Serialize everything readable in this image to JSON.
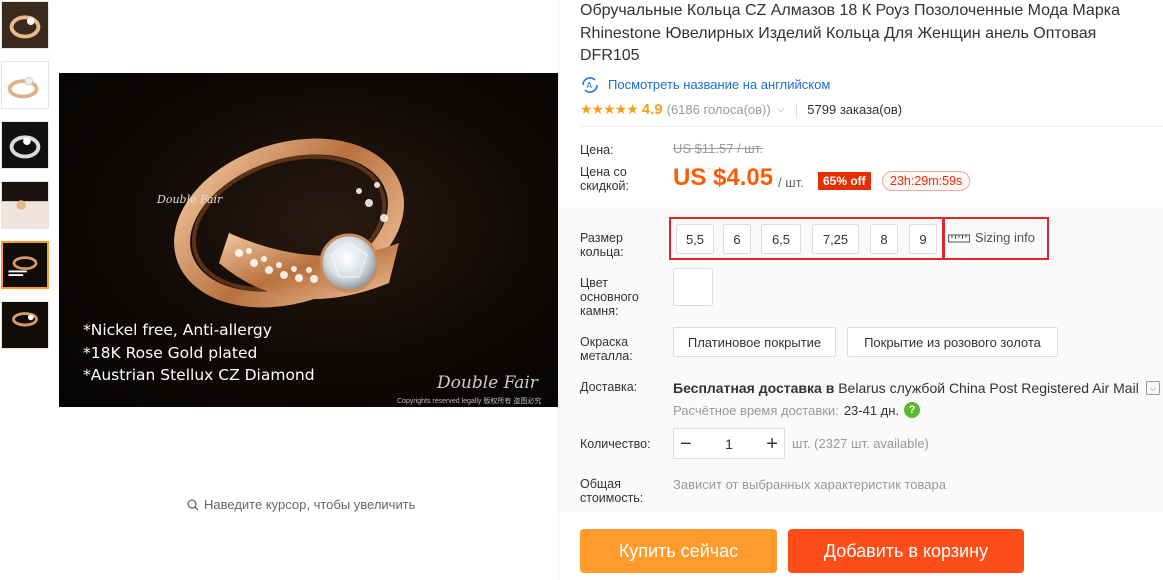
{
  "title": "Обручальные Кольца CZ Алмазов 18 К Роуз Позолоченные Мода Марка Rhinestone Ювелирных Изделий Кольца Для Женщин анель Оптовая DFR105",
  "translate_link": "Посмотреть название на английском",
  "rating": {
    "value": "4.9",
    "votes": "(6186 голоса(ов))",
    "orders": "5799 заказа(ов)",
    "stars": 5
  },
  "price": {
    "label": "Цена:",
    "old": "US $11.57 / шт.",
    "discount_label_1": "Цена со",
    "discount_label_2": "скидкой:",
    "new": "US $4.05",
    "per": "/ шт.",
    "off": "65% off",
    "timer": "23h:29m:59s"
  },
  "ring_size": {
    "label_1": "Размер",
    "label_2": "кольца:",
    "options": [
      "5,5",
      "6",
      "6,5",
      "7,25",
      "8",
      "9"
    ],
    "sizing_info": "Sizing info"
  },
  "stone_color": {
    "label_1": "Цвет",
    "label_2": "основного",
    "label_3": "камня:"
  },
  "metal": {
    "label_1": "Окраска",
    "label_2": "металла:",
    "options": [
      "Платиновое покрытие",
      "Покрытие из розового золота"
    ]
  },
  "shipping": {
    "label": "Доставка:",
    "free": "Бесплатная доставка в",
    "rest": " Belarus службой China Post Registered Air Mail",
    "est_label": "Расчётное время доставки:",
    "days": "23-41 дн."
  },
  "quantity": {
    "label": "Количество:",
    "value": "1",
    "available": "шт. (2327 шт. available)"
  },
  "total": {
    "label_1": "Общая",
    "label_2": "стоимость:",
    "note": "Зависит от выбранных характеристик товара"
  },
  "buttons": {
    "buy": "Купить сейчас",
    "cart": "Добавить в корзину"
  },
  "image": {
    "features": [
      "*Nickel free, Anti-allergy",
      "*18K Rose Gold plated",
      "*Austrian Stellux CZ Diamond"
    ],
    "brand": "Double Fair",
    "copyright": "Copyrights reserved legally 版权所有 盗图必究"
  },
  "zoom_hint": "Наведите курсор, чтобы увеличить",
  "colors": {
    "accent": "#ff5b07",
    "buy": "#ff9a2c",
    "cart": "#ff4d1a",
    "highlight": "#e0262b",
    "link": "#1a6dd8"
  }
}
